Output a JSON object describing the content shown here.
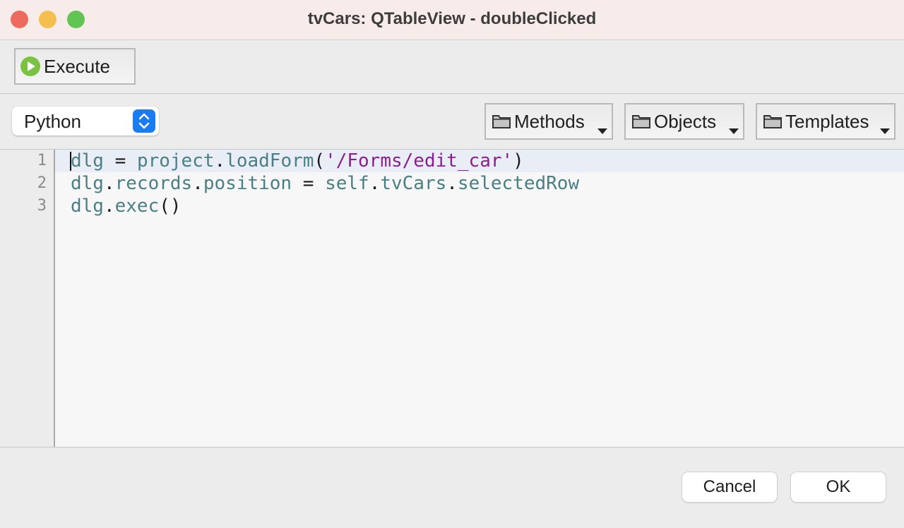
{
  "window": {
    "title": "tvCars: QTableView - doubleClicked"
  },
  "toolbar": {
    "execute_label": "Execute"
  },
  "language": {
    "selected": "Python"
  },
  "menus": {
    "methods": "Methods",
    "objects": "Objects",
    "templates": "Templates"
  },
  "editor": {
    "line_numbers": [
      "1",
      "2",
      "3"
    ],
    "lines": [
      [
        {
          "t": "ident",
          "v": "dlg"
        },
        {
          "t": "op",
          "v": " = "
        },
        {
          "t": "ident",
          "v": "project"
        },
        {
          "t": "op",
          "v": "."
        },
        {
          "t": "ident",
          "v": "loadForm"
        },
        {
          "t": "op",
          "v": "("
        },
        {
          "t": "str",
          "v": "'/Forms/edit_car'"
        },
        {
          "t": "op",
          "v": ")"
        }
      ],
      [
        {
          "t": "ident",
          "v": "dlg"
        },
        {
          "t": "op",
          "v": "."
        },
        {
          "t": "ident",
          "v": "records"
        },
        {
          "t": "op",
          "v": "."
        },
        {
          "t": "ident",
          "v": "position"
        },
        {
          "t": "op",
          "v": " = "
        },
        {
          "t": "ident",
          "v": "self"
        },
        {
          "t": "op",
          "v": "."
        },
        {
          "t": "ident",
          "v": "tvCars"
        },
        {
          "t": "op",
          "v": "."
        },
        {
          "t": "ident",
          "v": "selectedRow"
        }
      ],
      [
        {
          "t": "ident",
          "v": "dlg"
        },
        {
          "t": "op",
          "v": "."
        },
        {
          "t": "ident",
          "v": "exec"
        },
        {
          "t": "op",
          "v": "()"
        }
      ]
    ]
  },
  "dialog": {
    "cancel": "Cancel",
    "ok": "OK"
  },
  "colors": {
    "close": "#ed6a5e",
    "minimize": "#f5bf4f",
    "maximize": "#61c554",
    "execute_icon": "#7cc242",
    "stepper": "#1a7cf5"
  }
}
